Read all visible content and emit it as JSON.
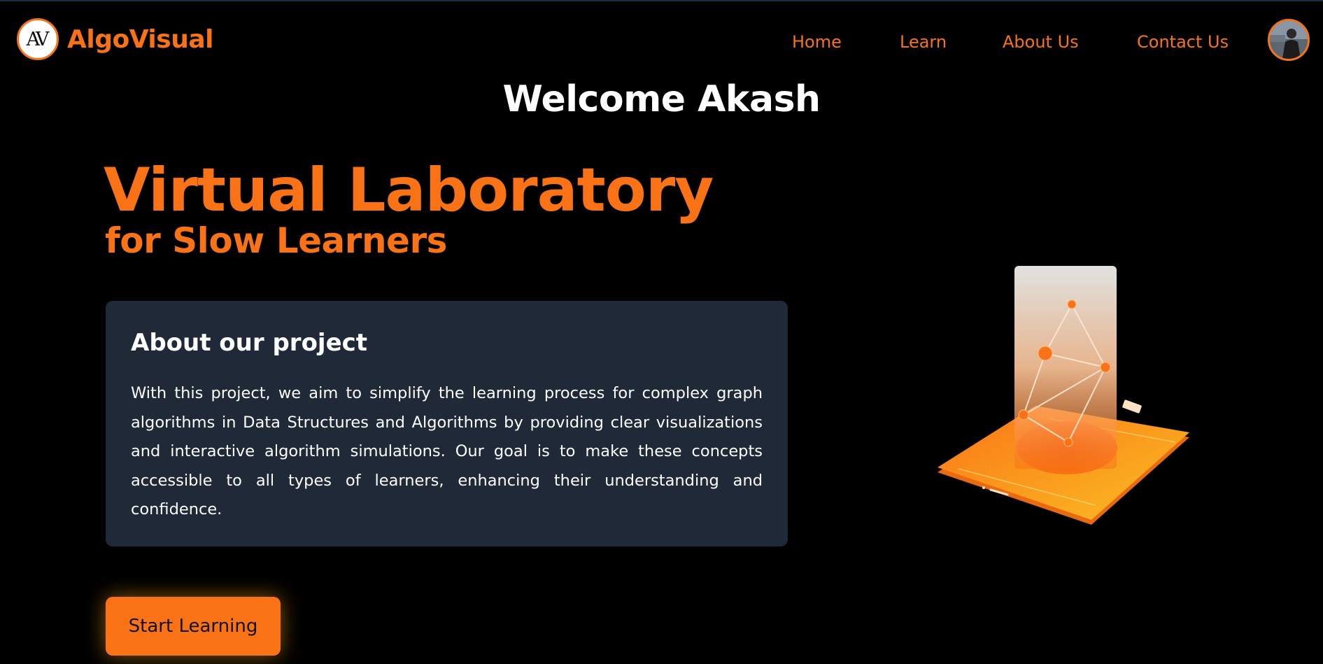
{
  "navbar": {
    "logo_text": "AV",
    "brand": "AlgoVisual",
    "links": [
      "Home",
      "Learn",
      "About Us",
      "Contact Us"
    ]
  },
  "welcome": "Welcome Akash",
  "hero": {
    "title": "Virtual Laboratory",
    "subtitle": "for Slow Learners"
  },
  "about": {
    "heading": "About our project",
    "body": "With this project, we aim to simplify the learning process for complex graph algorithms in Data Structures and Algorithms by providing clear visualizations and interactive algorithm simulations. Our goal is to make these concepts accessible to all types of learners, enhancing their understanding and confidence."
  },
  "cta": {
    "label": "Start Learning"
  },
  "colors": {
    "accent": "#f97316",
    "background": "#000000",
    "card": "#1f2937",
    "text": "#ffffff"
  },
  "icons": {
    "logo": "av-monogram-logo",
    "avatar": "user-avatar",
    "illustration": "graph-network-phone-illustration"
  }
}
